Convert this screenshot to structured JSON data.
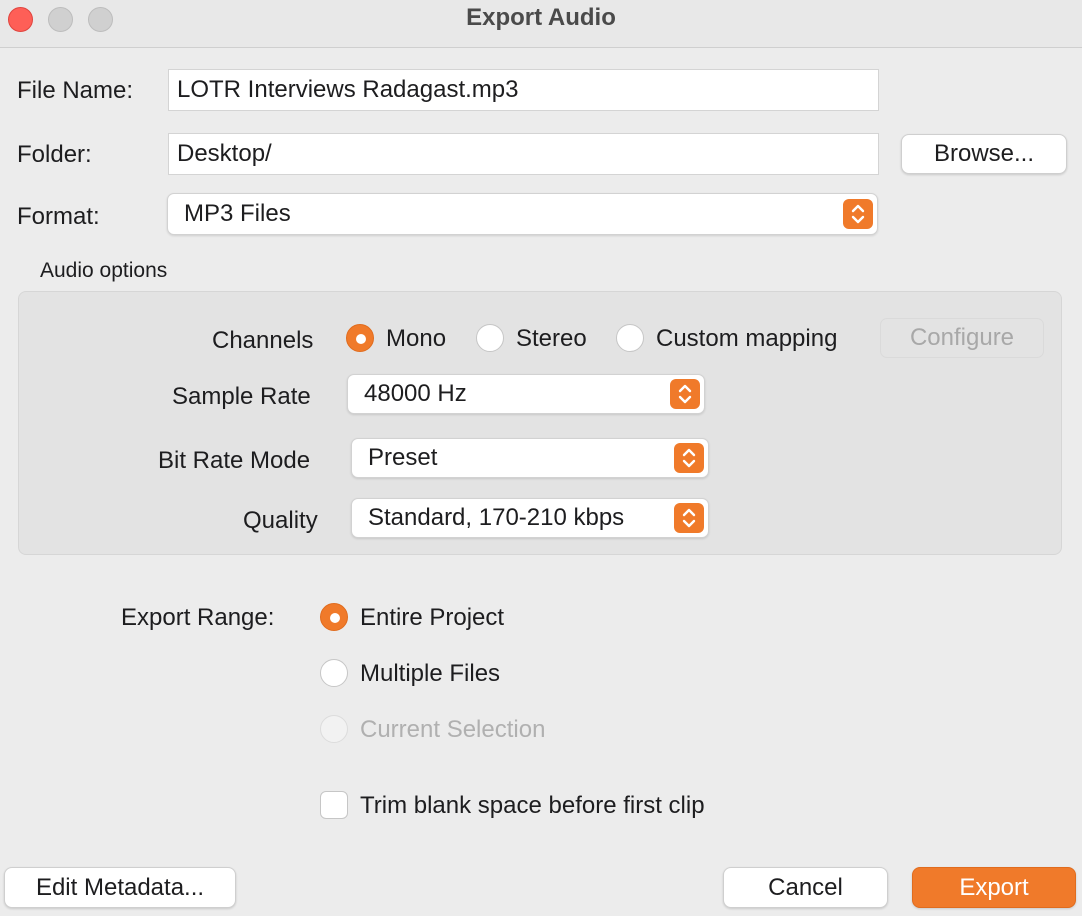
{
  "window": {
    "title": "Export Audio"
  },
  "file_name": {
    "label": "File Name:",
    "value": "LOTR Interviews Radagast.mp3"
  },
  "folder": {
    "label": "Folder:",
    "value": "Desktop/",
    "browse_label": "Browse..."
  },
  "format": {
    "label": "Format:",
    "selected": "MP3 Files"
  },
  "audio_options": {
    "heading": "Audio options",
    "channels": {
      "label": "Channels",
      "options": [
        "Mono",
        "Stereo",
        "Custom mapping"
      ],
      "selected": "Mono",
      "configure_label": "Configure"
    },
    "sample_rate": {
      "label": "Sample Rate",
      "selected": "48000 Hz"
    },
    "bit_rate_mode": {
      "label": "Bit Rate Mode",
      "selected": "Preset"
    },
    "quality": {
      "label": "Quality",
      "selected": "Standard, 170-210 kbps"
    }
  },
  "export_range": {
    "label": "Export Range:",
    "options": [
      "Entire Project",
      "Multiple Files",
      "Current Selection"
    ],
    "selected": "Entire Project",
    "disabled": [
      "Current Selection"
    ]
  },
  "trim": {
    "label": "Trim blank space before first clip",
    "checked": false
  },
  "footer": {
    "edit_metadata_label": "Edit Metadata...",
    "cancel_label": "Cancel",
    "export_label": "Export"
  },
  "colors": {
    "accent": "#f07a2a",
    "close": "#fe5f57"
  }
}
